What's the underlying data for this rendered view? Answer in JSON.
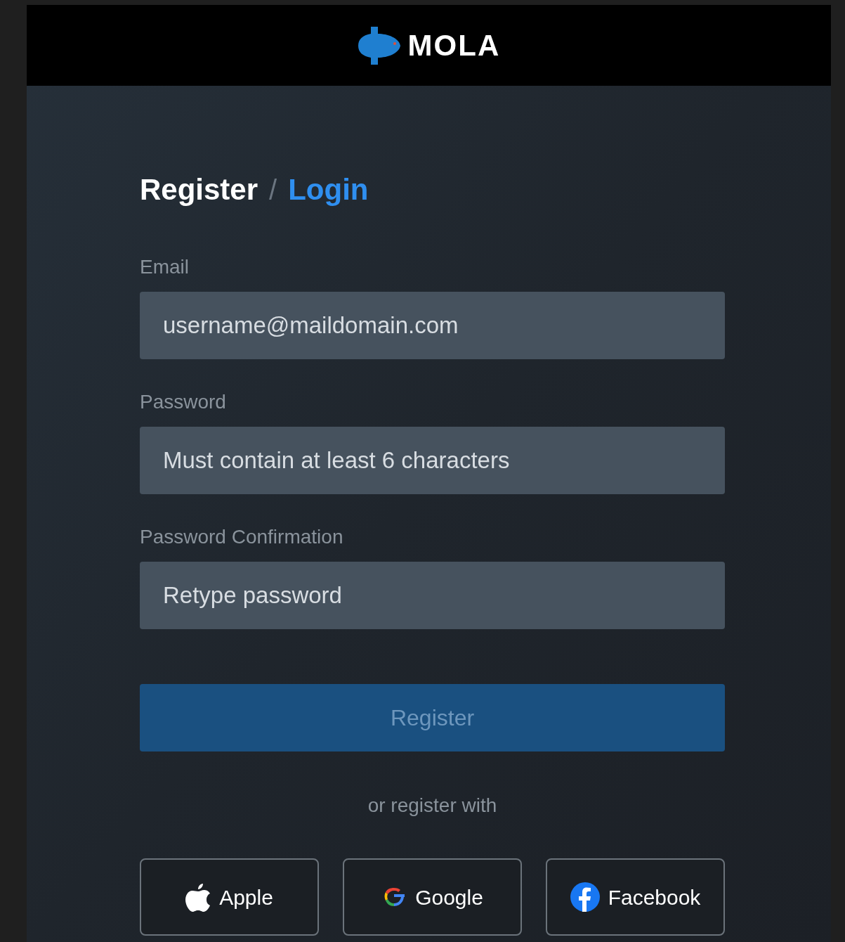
{
  "header": {
    "brand": "MOLA"
  },
  "tabs": [
    {
      "label": "Register",
      "selected": true
    },
    {
      "label": "Login",
      "selected": false
    }
  ],
  "tab_separator": "/",
  "fields": [
    {
      "label": "Email",
      "placeholder": "username@maildomain.com"
    },
    {
      "label": "Password",
      "placeholder": "Must contain at least 6 characters"
    },
    {
      "label": "Password Confirmation",
      "placeholder": "Retype password"
    }
  ],
  "submit": {
    "label": "Register",
    "disabled": true
  },
  "divider_text": "or register with",
  "social_buttons": [
    {
      "kind": "apple",
      "label": "Apple"
    },
    {
      "kind": "google",
      "label": "Google"
    },
    {
      "kind": "facebook",
      "label": "Facebook"
    }
  ]
}
